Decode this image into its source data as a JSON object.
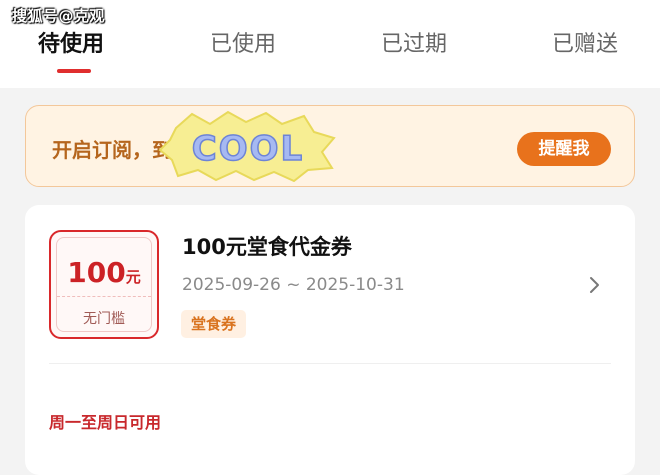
{
  "watermark": "搜狐号@克观",
  "tabs": [
    {
      "label": "待使用",
      "active": true
    },
    {
      "label": "已使用",
      "active": false
    },
    {
      "label": "已过期",
      "active": false
    },
    {
      "label": "已赠送",
      "active": false
    }
  ],
  "banner": {
    "text": "开启订阅，到期提醒",
    "sticker_text": "COOL",
    "button_label": "提醒我"
  },
  "coupon": {
    "amount": "100",
    "unit": "元",
    "threshold": "无门槛",
    "title": "100元堂食代金券",
    "validity": "2025-09-26 ~ 2025-10-31",
    "tag": "堂食券",
    "usage_note": "周一至周日可用"
  },
  "icons": {
    "chevron": "chevron-right-icon",
    "sticker": "cool-sticker"
  },
  "colors": {
    "accent_red": "#e02e2e",
    "banner_orange": "#e8721c",
    "coupon_red": "#d9282b",
    "tag_orange": "#d9731f"
  }
}
